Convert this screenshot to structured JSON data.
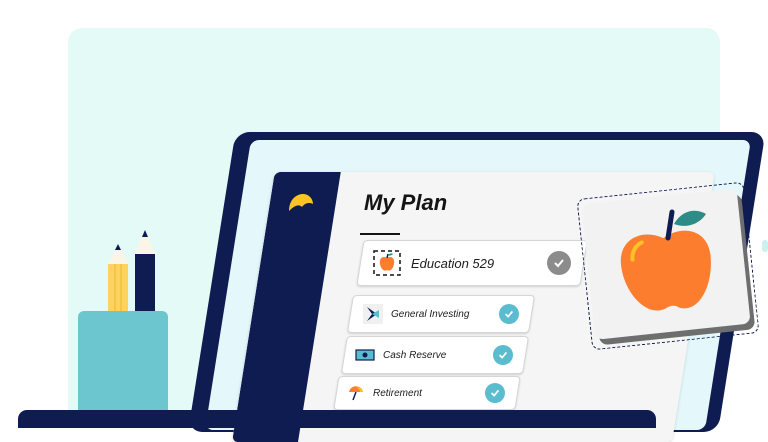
{
  "app": {
    "title": "My Plan"
  },
  "plan_items": [
    {
      "label": "Education 529",
      "icon": "apple-icon",
      "status": "inactive-check"
    },
    {
      "label": "General Investing",
      "icon": "investing-icon",
      "status": "check"
    },
    {
      "label": "Cash Reserve",
      "icon": "cash-icon",
      "status": "check"
    },
    {
      "label": "Retirement",
      "icon": "umbrella-icon",
      "status": "check"
    }
  ],
  "colors": {
    "navy": "#0f1c52",
    "teal_check": "#5bbccf",
    "grey_check": "#8c8c8c",
    "apple_orange": "#fd7d2f",
    "logo_yellow": "#fcc226",
    "backdrop_mint": "#e3faf6",
    "cup_blue": "#6cc6d0"
  }
}
